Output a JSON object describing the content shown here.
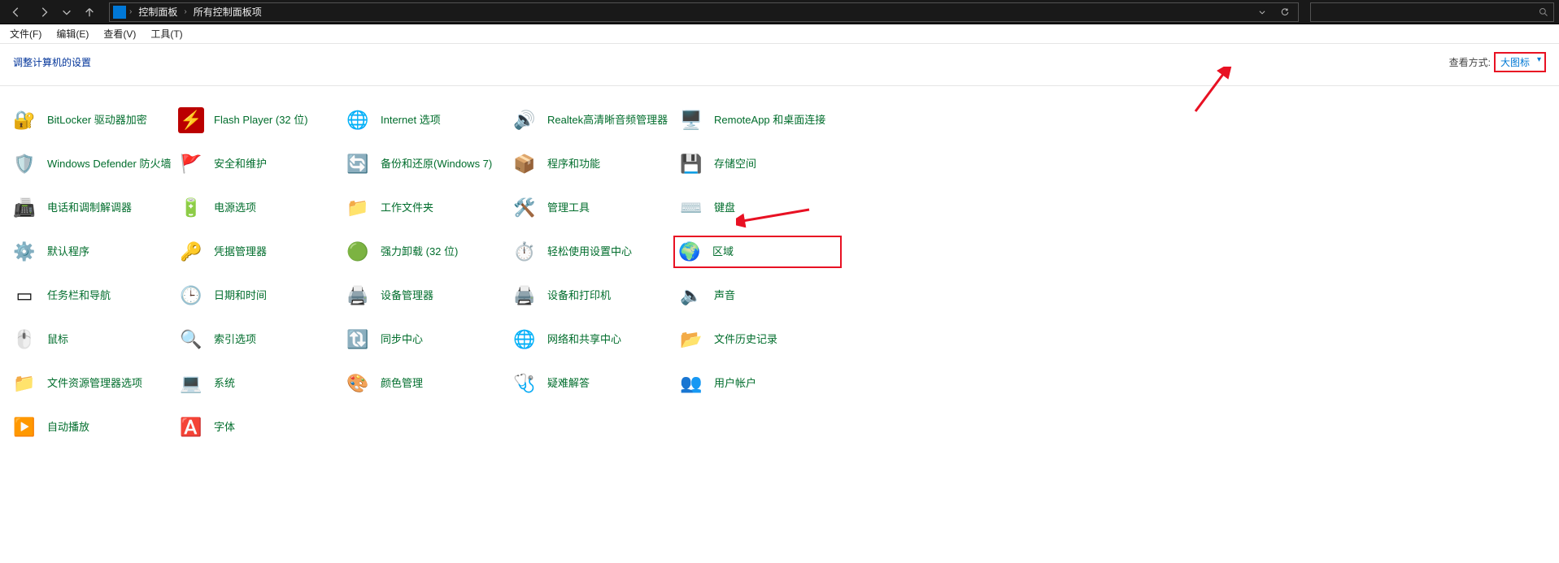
{
  "titlebar": {
    "breadcrumb1": "控制面板",
    "breadcrumb2": "所有控制面板项"
  },
  "menubar": {
    "file": "文件(F)",
    "edit": "编辑(E)",
    "view": "查看(V)",
    "tools": "工具(T)"
  },
  "header": {
    "title": "调整计算机的设置",
    "view_label": "查看方式:",
    "view_value": "大图标"
  },
  "items": [
    [
      {
        "id": "bitlocker",
        "label": "BitLocker 驱动器加密",
        "icon": "🔐",
        "bg": ""
      },
      {
        "id": "flash",
        "label": "Flash Player (32 位)",
        "icon": "⚡",
        "bg": "#b00"
      },
      {
        "id": "internet",
        "label": "Internet 选项",
        "icon": "🌐",
        "bg": ""
      },
      {
        "id": "realtek",
        "label": "Realtek高清晰音频管理器",
        "icon": "🔊",
        "bg": ""
      },
      {
        "id": "remoteapp",
        "label": "RemoteApp 和桌面连接",
        "icon": "🖥️",
        "bg": ""
      }
    ],
    [
      {
        "id": "defender",
        "label": "Windows Defender 防火墙",
        "icon": "🛡️",
        "bg": ""
      },
      {
        "id": "security",
        "label": "安全和维护",
        "icon": "🚩",
        "bg": ""
      },
      {
        "id": "backup",
        "label": "备份和还原(Windows 7)",
        "icon": "🔄",
        "bg": ""
      },
      {
        "id": "programs",
        "label": "程序和功能",
        "icon": "📦",
        "bg": ""
      },
      {
        "id": "storage",
        "label": "存储空间",
        "icon": "💾",
        "bg": ""
      }
    ],
    [
      {
        "id": "phone",
        "label": "电话和调制解调器",
        "icon": "📠",
        "bg": ""
      },
      {
        "id": "power",
        "label": "电源选项",
        "icon": "🔋",
        "bg": ""
      },
      {
        "id": "workfolders",
        "label": "工作文件夹",
        "icon": "📁",
        "bg": ""
      },
      {
        "id": "admintools",
        "label": "管理工具",
        "icon": "🛠️",
        "bg": ""
      },
      {
        "id": "keyboard",
        "label": "键盘",
        "icon": "⌨️",
        "bg": ""
      }
    ],
    [
      {
        "id": "defaultprog",
        "label": "默认程序",
        "icon": "⚙️",
        "bg": ""
      },
      {
        "id": "credential",
        "label": "凭据管理器",
        "icon": "🔑",
        "bg": ""
      },
      {
        "id": "uninstall",
        "label": "强力卸载 (32 位)",
        "icon": "🟢",
        "bg": ""
      },
      {
        "id": "ease",
        "label": "轻松使用设置中心",
        "icon": "⏱️",
        "bg": ""
      },
      {
        "id": "region",
        "label": "区域",
        "icon": "🌍",
        "bg": "",
        "highlight": true
      }
    ],
    [
      {
        "id": "taskbar",
        "label": "任务栏和导航",
        "icon": "▭",
        "bg": ""
      },
      {
        "id": "datetime",
        "label": "日期和时间",
        "icon": "🕒",
        "bg": ""
      },
      {
        "id": "devicemgr",
        "label": "设备管理器",
        "icon": "🖨️",
        "bg": ""
      },
      {
        "id": "devices",
        "label": "设备和打印机",
        "icon": "🖨️",
        "bg": ""
      },
      {
        "id": "sound",
        "label": "声音",
        "icon": "🔈",
        "bg": ""
      }
    ],
    [
      {
        "id": "mouse",
        "label": "鼠标",
        "icon": "🖱️",
        "bg": ""
      },
      {
        "id": "indexing",
        "label": "索引选项",
        "icon": "🔍",
        "bg": ""
      },
      {
        "id": "sync",
        "label": "同步中心",
        "icon": "🔃",
        "bg": ""
      },
      {
        "id": "network",
        "label": "网络和共享中心",
        "icon": "🌐",
        "bg": ""
      },
      {
        "id": "filehistory",
        "label": "文件历史记录",
        "icon": "📂",
        "bg": ""
      }
    ],
    [
      {
        "id": "explorer",
        "label": "文件资源管理器选项",
        "icon": "📁",
        "bg": ""
      },
      {
        "id": "system",
        "label": "系统",
        "icon": "💻",
        "bg": ""
      },
      {
        "id": "color",
        "label": "颜色管理",
        "icon": "🎨",
        "bg": ""
      },
      {
        "id": "troubleshoot",
        "label": "疑难解答",
        "icon": "🩺",
        "bg": ""
      },
      {
        "id": "users",
        "label": "用户帐户",
        "icon": "👥",
        "bg": ""
      }
    ],
    [
      {
        "id": "autoplay",
        "label": "自动播放",
        "icon": "▶️",
        "bg": ""
      },
      {
        "id": "fonts",
        "label": "字体",
        "icon": "🅰️",
        "bg": ""
      }
    ]
  ]
}
